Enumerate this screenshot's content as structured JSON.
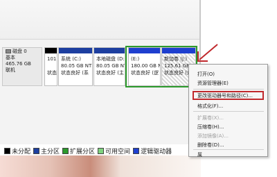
{
  "disk": {
    "name": "磁盘 0",
    "type": "基本",
    "size": "465.76 GB",
    "status": "联机"
  },
  "partitions": [
    {
      "label": "",
      "size": "101",
      "fs": "",
      "status": "状态"
    },
    {
      "label": "系统 (C:)",
      "size": "80.05 GB NTI",
      "status": "状态良好 (系"
    },
    {
      "label": "本地磁盘 (D:)",
      "size": "80.05 GB NTI",
      "status": "状态良好 (主"
    },
    {
      "label": "(E:)",
      "size": "180.00 GB NT",
      "status": "状态良好 (逻"
    },
    {
      "label": "新加卷 (J:)",
      "size": "125.61 GB NT",
      "status": "状态良好 (逻"
    }
  ],
  "legend": [
    {
      "label": "未分配",
      "color": "#000000"
    },
    {
      "label": "主分区",
      "color": "#1d3fa0"
    },
    {
      "label": "扩展分区",
      "color": "#2c9a2c"
    },
    {
      "label": "可用空间",
      "color": "#7fd37f"
    },
    {
      "label": "逻辑驱动器",
      "color": "#1e3fcf"
    }
  ],
  "context_menu": {
    "items": [
      {
        "label": "打开(O)",
        "enabled": true
      },
      {
        "label": "资源管理器(E)",
        "enabled": true
      },
      {
        "label": "更改驱动器号和路径(C)...",
        "enabled": true
      },
      {
        "label": "格式化(F)...",
        "enabled": true
      },
      {
        "label": "扩展卷(X)...",
        "enabled": false
      },
      {
        "label": "压缩卷(H)...",
        "enabled": true
      },
      {
        "label": "添加镜像(A)...",
        "enabled": false
      },
      {
        "label": "删除卷(D)...",
        "enabled": true
      },
      {
        "label": "属",
        "enabled": true
      }
    ]
  },
  "colors": {
    "primary_bar": "#1d3fa0",
    "logical_bar": "#1e3fcf",
    "unallocated_bar": "#000000",
    "extended_border": "#2c9a2c",
    "highlight_red": "#c0282c"
  }
}
